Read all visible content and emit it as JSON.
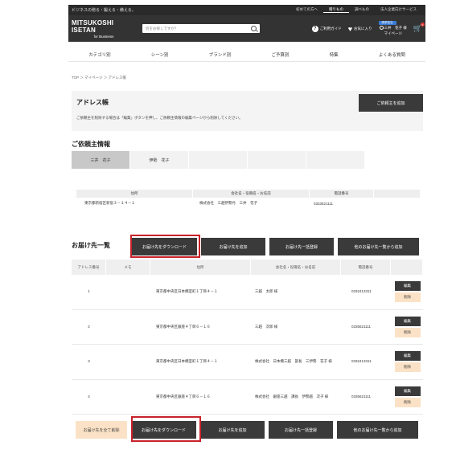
{
  "topbar": {
    "tagline": "ビジネスの贈る・鍛える・備える。",
    "links": [
      "初めての方へ",
      "贈りもの",
      "調べもの",
      "法人企業向けサービス"
    ]
  },
  "header": {
    "logo_main": "MITSUKOSHI ISETAN",
    "logo_sub": "for Business",
    "search_placeholder": "何をお探しですか？",
    "guide": "ご利用ガイド",
    "favorites": "お気に入り",
    "account_badge": "請求担当",
    "account_name": "三井　花子 様",
    "mypage": "マイページ",
    "cart_count": "0"
  },
  "nav": [
    "カテゴリ別",
    "シーン別",
    "ブランド別",
    "ご予算別",
    "特集",
    "よくある質問"
  ],
  "breadcrumb": "TOP ＞ マイページ ＞ アドレス帳",
  "address_book": {
    "title": "アドレス帳",
    "description": "ご依頼主を削除する場合は「編集」ボタンを押し、ご依頼主情報の編集ページから削除してください。",
    "add_requester": "ご依頼主を追加"
  },
  "requester": {
    "title": "ご依頼主情報",
    "tabs": [
      "三井　花子",
      "伊勢　花子",
      "",
      "",
      ""
    ],
    "headers": [
      "住所",
      "会社名・役職名・お名前",
      "電話番号"
    ],
    "row": [
      "東京都新宿区新宿３－１４－１",
      "株式会社　三越伊勢丹　三井　花子",
      "0333521111"
    ]
  },
  "delivery": {
    "title": "お届け先一覧",
    "download": "お届け先をダウンロード",
    "add": "お届け先を追加",
    "bulk": "お届け先一括登録",
    "add_from_other": "他のお届け先一覧から追加",
    "delete_all": "お届け先を全て削除",
    "headers": [
      "アドレス番号",
      "メモ",
      "住所",
      "会社名・役職名・お名前",
      "電話番号"
    ],
    "edit_label": "編集",
    "delete_label": "削除",
    "rows": [
      {
        "no": "1",
        "memo": "",
        "address": "東京都中央区日本橋室町１丁目４－１",
        "name": "三越　太郎 様",
        "phone": "0332413311"
      },
      {
        "no": "2",
        "memo": "",
        "address": "東京都中央区銀座４丁目６－１６",
        "name": "三越　次郎 様",
        "phone": "0335621111"
      },
      {
        "no": "3",
        "memo": "",
        "address": "東京都中央区日本橋室町１丁目４－１",
        "name": "株式会社　日本橋三越　部長　三伊勢　花子 様",
        "phone": "0332413311"
      },
      {
        "no": "4",
        "memo": "",
        "address": "東京都中央区銀座４丁目６－１６",
        "name": "株式会社　銀座三越　課長　伊勢越　次子 様",
        "phone": "0335621111"
      }
    ]
  }
}
